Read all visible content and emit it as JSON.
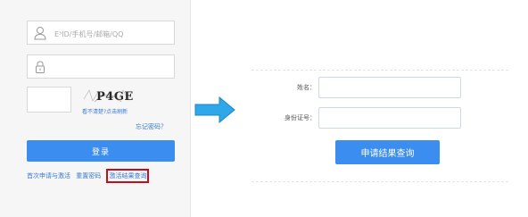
{
  "login": {
    "account_placeholder": "E³ID/手机号/邮箱/QQ",
    "password_placeholder": "",
    "captcha_text": "P4GE",
    "captcha_tip": "看不清楚?点击刷新",
    "forgot_password": "忘记密码？",
    "login_button": "登录",
    "links": {
      "first_apply": "首次申请与激活",
      "reset_password": "重置密码",
      "activation_query": "激活结果查询"
    }
  },
  "query_form": {
    "name_label": "姓名：",
    "id_label": "身份证号：",
    "submit_button": "申请结果查询"
  },
  "colors": {
    "accent": "#3c8df0",
    "highlight_border": "#c0101c",
    "arrow": "#2ea8e8"
  }
}
